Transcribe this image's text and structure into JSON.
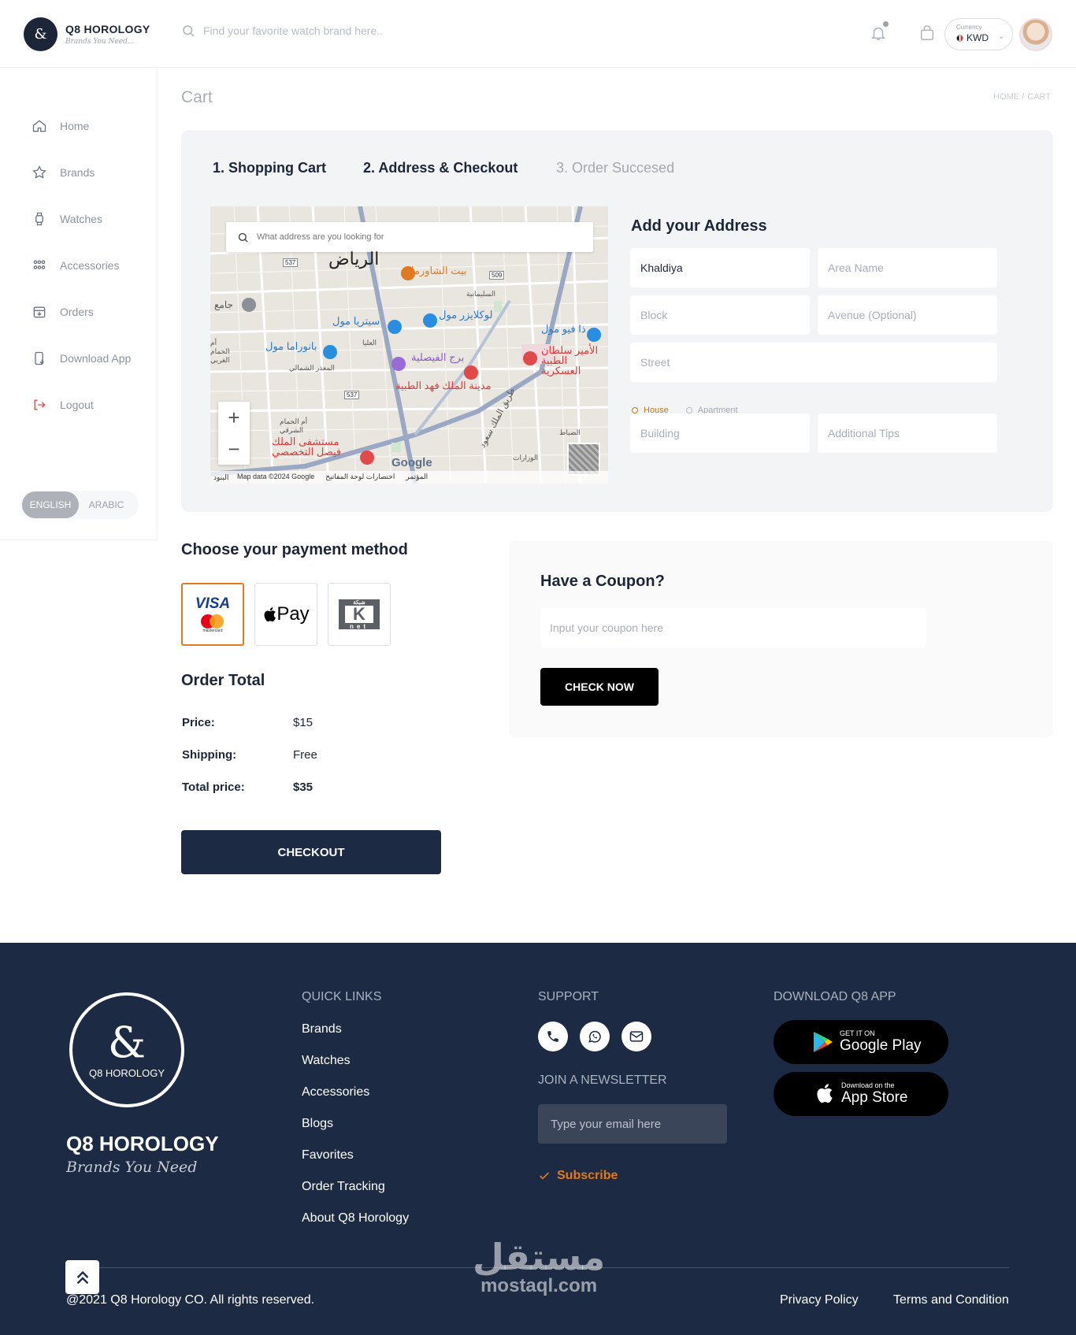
{
  "header": {
    "brand": "Q8 HOROLOGY",
    "tagline": "Brands You Need...",
    "search_placeholder": "Find your favorite watch brand here..",
    "currency_label": "Currency",
    "currency_value": "KWD"
  },
  "sidebar": {
    "items": [
      {
        "label": "Home",
        "icon": "home-icon"
      },
      {
        "label": "Brands",
        "icon": "star-icon"
      },
      {
        "label": "Watches",
        "icon": "watch-icon"
      },
      {
        "label": "Accessories",
        "icon": "grid-dots-icon"
      },
      {
        "label": "Orders",
        "icon": "box-icon"
      },
      {
        "label": "Download App",
        "icon": "phone-download-icon"
      },
      {
        "label": "Logout",
        "icon": "logout-icon"
      }
    ],
    "lang_english": "ENGLISH",
    "lang_arabic": "ARABIC"
  },
  "page": {
    "title": "Cart",
    "breadcrumb_home": "HOME /",
    "breadcrumb_current": "CART"
  },
  "steps": {
    "step1": "1. Shopping Cart",
    "step2": "2. Address & Checkout",
    "step3": "3. Order Succesed"
  },
  "map": {
    "search_placeholder": "What address are you looking for",
    "credit": "Map data ©2024 Google",
    "shortcuts": "اختصارات لوحة المفاتيح",
    "terms": "البنود",
    "report": "المؤتمر",
    "provider": "Google",
    "city_label": "الرياض",
    "places": [
      "بيت الشاورما",
      "لوكلايزر مول",
      "سيتريا مول",
      "بانوراما مول",
      "برج الفيصلية",
      "ذا فيو مول",
      "مدينة الملك فهد الطبية",
      "الأمير سلطان الطبية العسكرية",
      "مستشفى الملك فيصل التخصصي",
      "جامع",
      "طريق الملك سعود",
      "السليمانية",
      "العليا",
      "المعذر الشمالي",
      "أم الحمام الشرقي",
      "أم الحمام الغربي",
      "الضباط",
      "الوزارات"
    ],
    "road_numbers": [
      "537",
      "509",
      "537"
    ]
  },
  "address": {
    "title": "Add your Address",
    "area_value": "Khaldiya",
    "area_name_placeholder": "Area Name",
    "block_placeholder": "Block",
    "avenue_placeholder": "Avenue (Optional)",
    "street_placeholder": "Street",
    "type_house": "House",
    "type_apartment": "Apartment",
    "building_placeholder": "Building",
    "tips_placeholder": "Additional Tips"
  },
  "payment": {
    "title": "Choose your payment method",
    "visa_label": "VISA",
    "mastercard_label": "mastercard",
    "applepay_label": "Pay",
    "knet_label": "K",
    "knet_sub": "net",
    "knet_top": "شبكة",
    "selected": "visa"
  },
  "order": {
    "title": "Order Total",
    "price_label": "Price:",
    "price_value": "$15",
    "shipping_label": "Shipping:",
    "shipping_value": "Free",
    "total_label": "Total price:",
    "total_value": "$35",
    "checkout_label": "CHECKOUT"
  },
  "coupon": {
    "title": "Have a Coupon?",
    "placeholder": "Input your coupon here",
    "button": "CHECK NOW"
  },
  "footer": {
    "brand": "Q8 HOROLOGY",
    "tagline": "Brands You Need",
    "logo_small": "Q8 HOROLOGY",
    "quick_links_title": "QUICK LINKS",
    "quick_links": [
      "Brands",
      "Watches",
      "Accessories",
      "Blogs",
      "Favorites",
      "Order Tracking",
      "About Q8 Horology"
    ],
    "support_title": "SUPPORT",
    "newsletter_title": "JOIN A NEWSLETTER",
    "newsletter_placeholder": "Type your email here",
    "subscribe": "Subscribe",
    "download_title": "DOWNLOAD Q8 APP",
    "google_small": "GET IT ON",
    "google_big": "Google Play",
    "apple_small": "Download on the",
    "apple_big": "App Store",
    "copyright": "@2021 Q8 Horology CO. All rights reserved.",
    "privacy": "Privacy Policy",
    "terms": "Terms and Condition",
    "watermark_ar": "مستقل",
    "watermark_en": "mostaql.com"
  },
  "colors": {
    "navy": "#1c2a44",
    "accent_orange": "#e07a1f",
    "panel_gray": "#f3f4f6"
  }
}
